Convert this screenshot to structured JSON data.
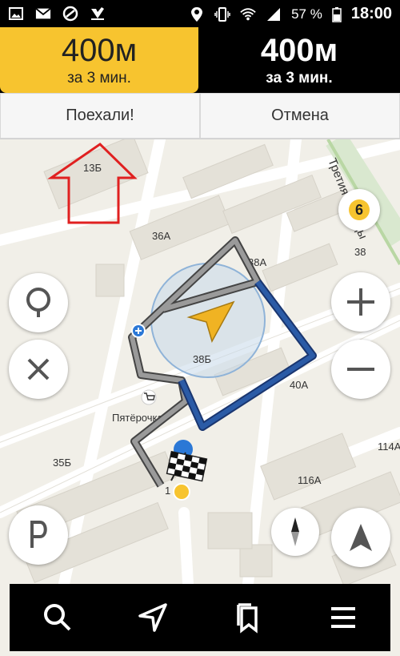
{
  "status_bar": {
    "battery_percent": "57 %",
    "time": "18:00",
    "icons_left": [
      "image-icon",
      "mail-icon",
      "block-icon",
      "check-icon"
    ],
    "icons_right": [
      "location-icon",
      "vibrate-icon",
      "wifi-icon",
      "signal-icon",
      "battery-icon"
    ]
  },
  "routes": [
    {
      "distance": "400м",
      "time": "за 3 мин.",
      "selected": true
    },
    {
      "distance": "400м",
      "time": "за 3 мин.",
      "selected": false
    }
  ],
  "actions": {
    "go_label": "Поехали!",
    "cancel_label": "Отмена"
  },
  "map": {
    "street_label": "Третия Победы",
    "labels": {
      "b13b": "13Б",
      "b36a": "36А",
      "b38a": "38А",
      "b38": "38",
      "b38b": "38Б",
      "b40a": "40А",
      "b35b": "35Б",
      "b116a": "116А",
      "b114a": "114А",
      "shop": "Пятёрочка",
      "b1": "1"
    },
    "traffic_score": "6",
    "colors": {
      "route": "#2b5ba6",
      "route_passed": "#9a9a9a",
      "accent": "#f7c42f",
      "guide_arrow": "#e02020"
    }
  },
  "controls": {
    "search_place": "pin-icon",
    "clear": "close-icon",
    "zoom_in": "plus-icon",
    "zoom_out": "minus-icon",
    "parking": "P",
    "compass": "compass-icon",
    "follow": "navigation-arrow-icon"
  },
  "bottom_nav": [
    "search-icon",
    "navigation-icon",
    "bookmarks-icon",
    "menu-icon"
  ]
}
